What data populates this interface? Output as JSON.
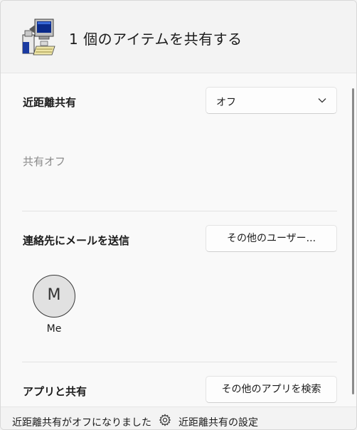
{
  "header": {
    "title": "1 個のアイテムを共有する",
    "icon": "computer-share-icon"
  },
  "nearby": {
    "label": "近距離共有",
    "dropdown_value": "オフ",
    "status": "共有オフ"
  },
  "email": {
    "label": "連絡先にメールを送信",
    "more_users_button": "その他のユーザー...",
    "contacts": [
      {
        "initial": "M",
        "name": "Me"
      }
    ]
  },
  "apps": {
    "label": "アプリと共有",
    "find_apps_button": "その他のアプリを検索"
  },
  "footer": {
    "status": "近距離共有がオフになりました",
    "settings_link": "近距離共有の設定",
    "settings_icon": "gear-icon"
  }
}
